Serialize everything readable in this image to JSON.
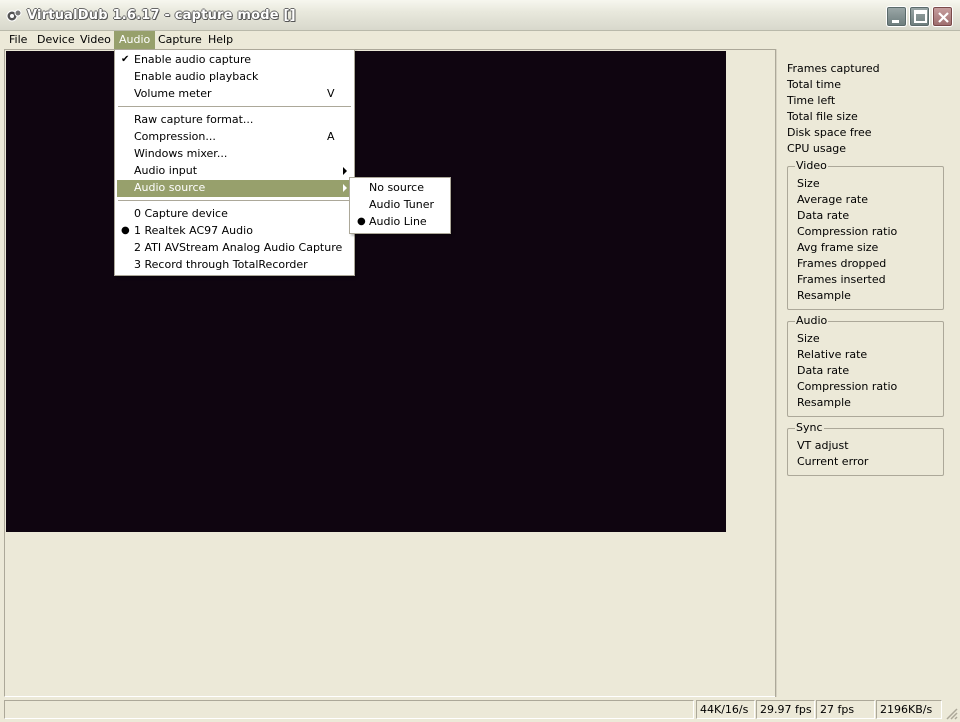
{
  "window": {
    "title": "VirtualDub 1.6.17 - capture mode []"
  },
  "menubar": {
    "items": [
      "File",
      "Device",
      "Video",
      "Audio",
      "Capture",
      "Help"
    ],
    "active": "Audio"
  },
  "audio_menu": {
    "enable_capture": "Enable audio capture",
    "enable_playback": "Enable audio playback",
    "volume_meter": "Volume meter",
    "volume_meter_key": "V",
    "raw_format": "Raw capture format...",
    "compression": "Compression...",
    "compression_key": "A",
    "windows_mixer": "Windows mixer...",
    "audio_input": "Audio input",
    "audio_source": "Audio source",
    "devices": [
      "0 Capture device",
      "1 Realtek AC97 Audio",
      "2 ATI AVStream Analog Audio Capture",
      "3 Record through TotalRecorder"
    ]
  },
  "source_submenu": {
    "items": [
      "No source",
      "Audio Tuner",
      "Audio Line"
    ],
    "selected": "Audio Line"
  },
  "stats": {
    "general": [
      "Frames captured",
      "Total time",
      "Time left",
      "Total file size",
      "Disk space free",
      "CPU usage"
    ],
    "video_title": "Video",
    "video": [
      "Size",
      "Average rate",
      "Data rate",
      "Compression ratio",
      "Avg frame size",
      "Frames dropped",
      "Frames inserted",
      "Resample"
    ],
    "audio_title": "Audio",
    "audio": [
      "Size",
      "Relative rate",
      "Data rate",
      "Compression ratio",
      "Resample"
    ],
    "sync_title": "Sync",
    "sync": [
      "VT adjust",
      "Current error"
    ]
  },
  "statusbar": {
    "audio_format": "44K/16/s",
    "frame_rate": "29.97 fps",
    "actual_fps": "27 fps",
    "data_rate": "2196KB/s"
  },
  "colors": {
    "menu_highlight": "#97a06c",
    "video_bg": "#0f0510",
    "window_bg": "#ece9d8"
  }
}
